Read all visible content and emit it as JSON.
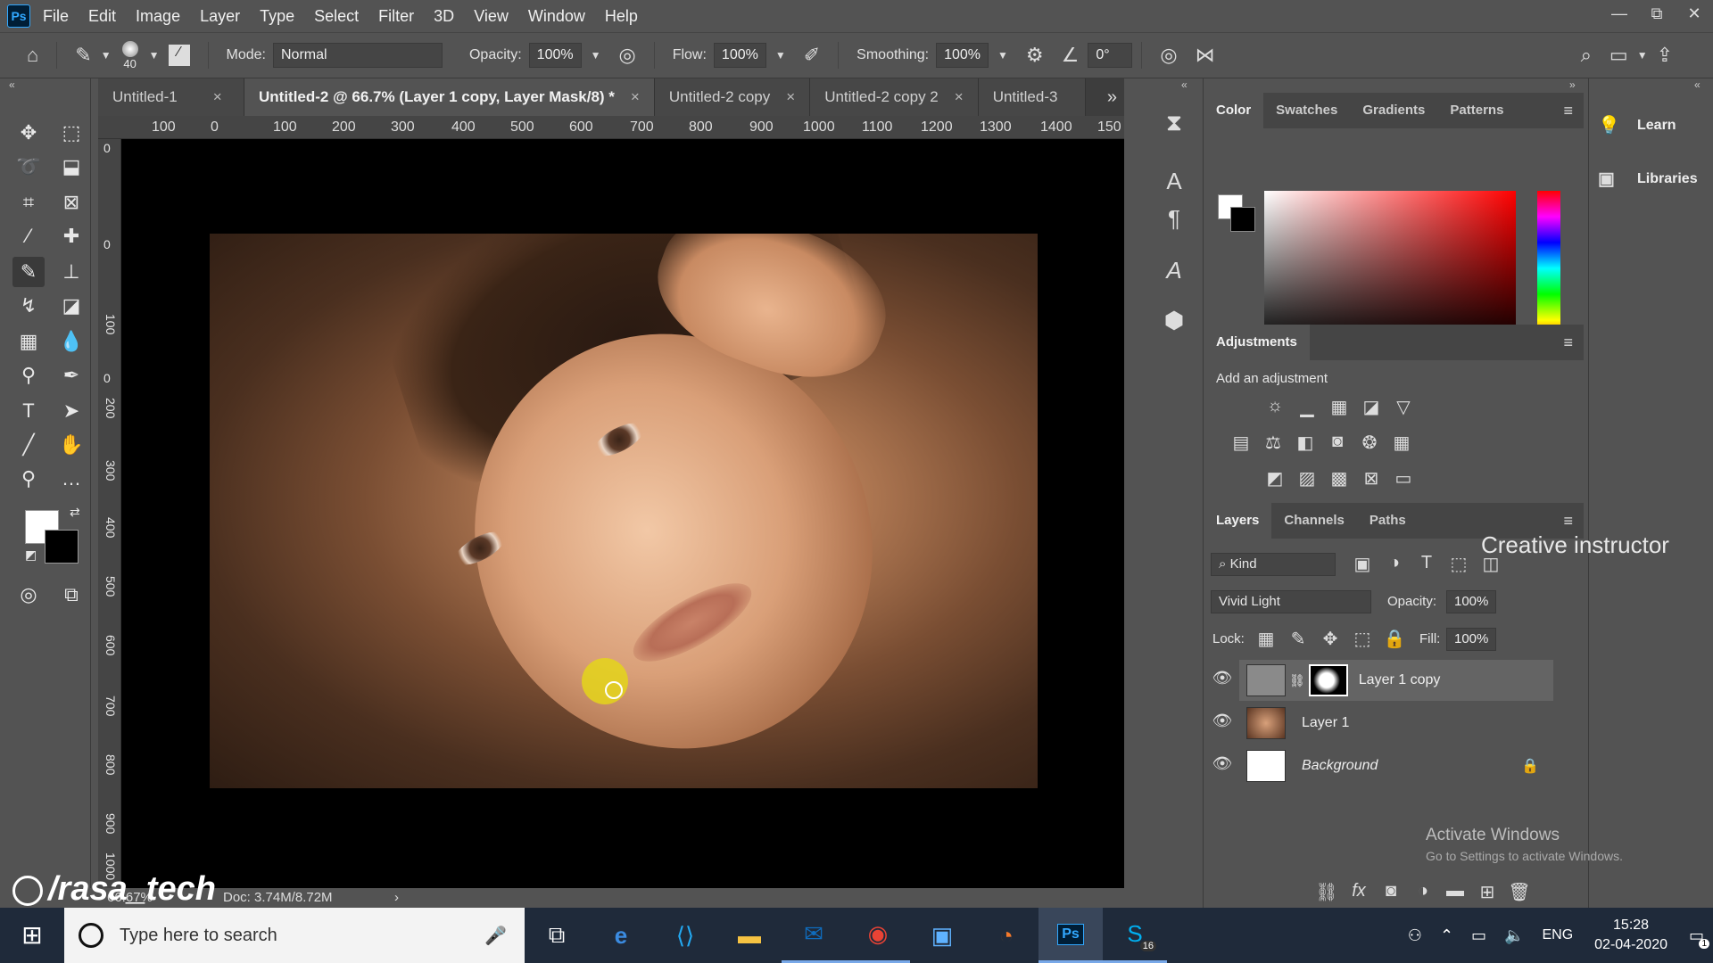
{
  "menubar": {
    "logo": "Ps",
    "items": [
      "File",
      "Edit",
      "Image",
      "Layer",
      "Type",
      "Select",
      "Filter",
      "3D",
      "View",
      "Window",
      "Help"
    ]
  },
  "window_controls": [
    "—",
    "⧉",
    "✕"
  ],
  "options_bar": {
    "brush_size": "40",
    "mode_label": "Mode:",
    "mode_value": "Normal",
    "opacity_label": "Opacity:",
    "opacity_value": "100%",
    "flow_label": "Flow:",
    "flow_value": "100%",
    "smoothing_label": "Smoothing:",
    "smoothing_value": "100%",
    "angle_value": "0°"
  },
  "tabs": [
    {
      "label": "Untitled-1",
      "close": "×"
    },
    {
      "label": "Untitled-2 @ 66.7% (Layer 1 copy, Layer Mask/8) *",
      "close": "×"
    },
    {
      "label": "Untitled-2 copy",
      "close": "×"
    },
    {
      "label": "Untitled-2 copy 2",
      "close": "×"
    },
    {
      "label": "Untitled-3",
      "close": ""
    }
  ],
  "ruler": {
    "h_ticks": [
      "100",
      "0",
      "100",
      "200",
      "300",
      "400",
      "500",
      "600",
      "700",
      "800",
      "900",
      "1000",
      "1100",
      "1200",
      "1300",
      "1400",
      "150"
    ],
    "v_ticks": [
      "0",
      "0",
      "100",
      "0",
      "200",
      "300",
      "400",
      "500",
      "600",
      "700",
      "800",
      "900",
      "1000"
    ]
  },
  "status": {
    "zoom": "66.67%",
    "doc": "Doc: 3.74M/8.72M"
  },
  "watermark_handle": "/rasa_tech",
  "watermark_name": "Creative instructor",
  "color_panel": {
    "tabs": [
      "Color",
      "Swatches",
      "Gradients",
      "Patterns"
    ]
  },
  "adjustments_panel": {
    "title": "Adjustments",
    "subtitle": "Add an adjustment"
  },
  "layers_panel": {
    "tabs": [
      "Layers",
      "Channels",
      "Paths"
    ],
    "filter_label": "Kind",
    "blend_mode": "Vivid Light",
    "opacity_label": "Opacity:",
    "opacity_value": "100%",
    "lock_label": "Lock:",
    "fill_label": "Fill:",
    "fill_value": "100%",
    "layers": [
      {
        "name": "Layer 1 copy",
        "selected": true
      },
      {
        "name": "Layer 1",
        "selected": false
      },
      {
        "name": "Background",
        "selected": false
      }
    ]
  },
  "learn_panel": {
    "items": [
      "Learn",
      "Libraries"
    ]
  },
  "activate_windows": {
    "title": "Activate Windows",
    "subtitle": "Go to Settings to activate Windows."
  },
  "taskbar": {
    "search_placeholder": "Type here to search",
    "language": "ENG",
    "time": "15:28",
    "date": "02-04-2020",
    "skype_badge": "16",
    "notification_badge": "1"
  },
  "colors": {
    "ui_bg": "#535353",
    "panel_dark": "#454545",
    "taskbar": "#1f2a3a",
    "cursor_highlight": "#e4d51a"
  }
}
